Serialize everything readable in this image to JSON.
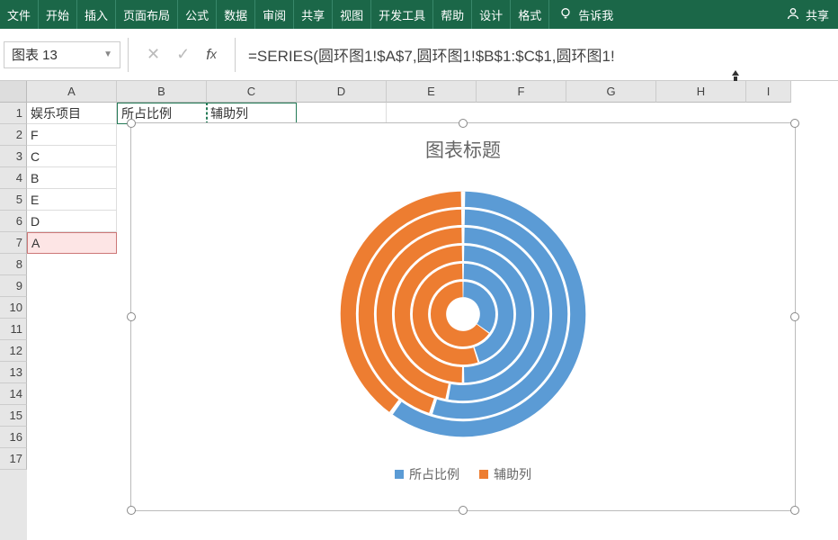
{
  "ribbon": {
    "tabs": [
      "文件",
      "开始",
      "插入",
      "页面布局",
      "公式",
      "数据",
      "审阅",
      "共享",
      "视图",
      "开发工具",
      "帮助",
      "设计",
      "格式"
    ],
    "tell_me": "告诉我",
    "share": "共享"
  },
  "formula_bar": {
    "name_box": "图表 13",
    "formula": "=SERIES(圆环图1!$A$7,圆环图1!$B$1:$C$1,圆环图1!"
  },
  "columns": [
    "A",
    "B",
    "C",
    "D",
    "E",
    "F",
    "G",
    "H",
    "I"
  ],
  "rows": [
    "1",
    "2",
    "3",
    "4",
    "5",
    "6",
    "7",
    "8",
    "9",
    "10",
    "11",
    "12",
    "13",
    "14",
    "15",
    "16",
    "17"
  ],
  "cells": {
    "A1": "娱乐项目",
    "B1": "所占比例",
    "C1": "辅助列",
    "A2": "F",
    "A3": "C",
    "A4": "B",
    "A5": "E",
    "A6": "D",
    "A7": "A"
  },
  "chart": {
    "title": "图表标题",
    "legend": {
      "series1": "所占比例",
      "series2": "辅助列"
    },
    "colors": {
      "series1": "#5b9bd5",
      "series2": "#ed7d31"
    }
  },
  "chart_data": {
    "type": "pie",
    "subtype": "nested-doughnut",
    "title": "图表标题",
    "series": [
      {
        "name": "所占比例",
        "color": "#5b9bd5"
      },
      {
        "name": "辅助列",
        "color": "#ed7d31"
      }
    ],
    "rings_outer_to_inner": [
      {
        "category": "F",
        "ratio_pct": 60,
        "aux_pct": 40
      },
      {
        "category": "C",
        "ratio_pct": 55,
        "aux_pct": 45
      },
      {
        "category": "B",
        "ratio_pct": 53,
        "aux_pct": 47
      },
      {
        "category": "E",
        "ratio_pct": 50,
        "aux_pct": 50
      },
      {
        "category": "D",
        "ratio_pct": 45,
        "aux_pct": 55
      },
      {
        "category": "A",
        "ratio_pct": 35,
        "aux_pct": 65
      }
    ],
    "note": "Each ring is one category; blue arc = 所占比例 starting at 12 o'clock clockwise, orange arc = 辅助列 remainder. Percentages estimated from arc lengths."
  }
}
